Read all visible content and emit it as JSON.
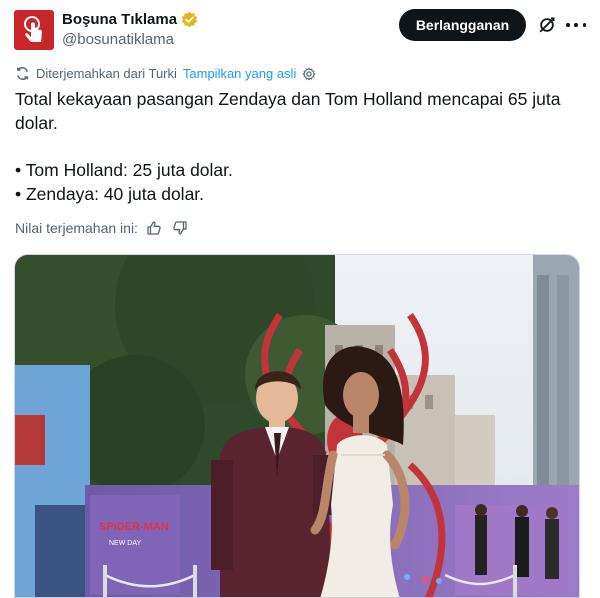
{
  "author": {
    "display_name": "Boşuna Tıklama",
    "handle": "@bosunatiklama",
    "verified_color": "#e2b719",
    "avatar_color": "#c8262b"
  },
  "actions": {
    "subscribe_label": "Berlangganan"
  },
  "translation": {
    "note": "Diterjemahkan dari Turki",
    "show_original": "Tampilkan yang asli"
  },
  "tweet": {
    "line1": "Total kekayaan pasangan Zendaya dan Tom Holland mencapai 65 juta dolar.",
    "bullet1": "• Tom Holland: 25 juta dolar.",
    "bullet2": "• Zendaya: 40 juta dolar."
  },
  "rate": {
    "label": "Nilai terjemahan ini:"
  },
  "media": {
    "backdrop_text": "SPIDER-MAN",
    "poster_text": "NEW DAY"
  },
  "colors": {
    "accent_link": "#1d9bf0",
    "text_primary": "#0f1419",
    "text_secondary": "#536471"
  }
}
